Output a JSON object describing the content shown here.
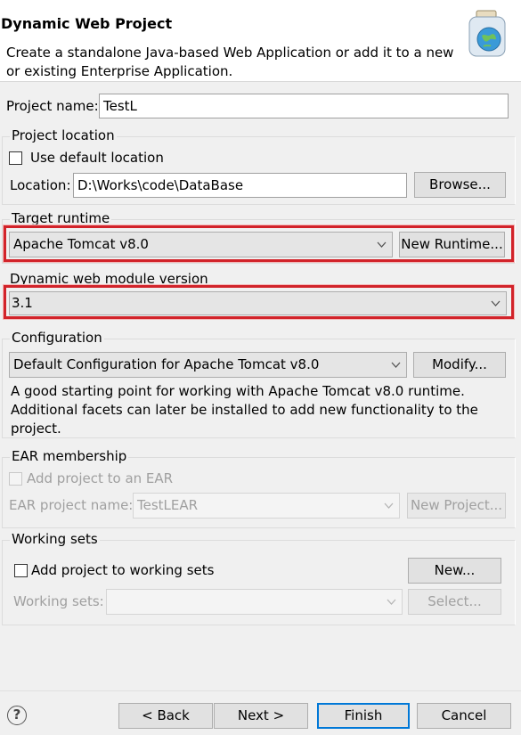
{
  "header": {
    "title": "Dynamic Web Project",
    "description": "Create a standalone Java-based Web Application or add it to a new or existing Enterprise Application.",
    "icon": "web-project-jar-icon"
  },
  "project_name": {
    "label": "Project name:",
    "value": "TestL"
  },
  "project_location": {
    "group_label": "Project location",
    "use_default_label": "Use default location",
    "use_default_checked": false,
    "location_label": "Location:",
    "location_value": "D:\\Works\\code\\DataBase",
    "browse_label": "Browse..."
  },
  "target_runtime": {
    "group_label": "Target runtime",
    "selected": "Apache Tomcat v8.0",
    "new_runtime_label": "New Runtime..."
  },
  "module_version": {
    "group_label": "Dynamic web module version",
    "selected": "3.1"
  },
  "configuration": {
    "group_label": "Configuration",
    "selected": "Default Configuration for Apache Tomcat v8.0",
    "modify_label": "Modify...",
    "description": "A good starting point for working with Apache Tomcat v8.0 runtime. Additional facets can later be installed to add new functionality to the project."
  },
  "ear_membership": {
    "group_label": "EAR membership",
    "add_label": "Add project to an EAR",
    "project_name_label": "EAR project name:",
    "project_name_value": "TestLEAR",
    "new_project_label": "New Project..."
  },
  "working_sets": {
    "group_label": "Working sets",
    "add_label": "Add project to working sets",
    "new_label": "New...",
    "sets_label": "Working sets:",
    "select_label": "Select..."
  },
  "footer": {
    "help_symbol": "?",
    "back_label": "< Back",
    "next_label": "Next >",
    "finish_label": "Finish",
    "cancel_label": "Cancel"
  },
  "colors": {
    "highlight": "#d2232a",
    "focus": "#0078d7"
  }
}
